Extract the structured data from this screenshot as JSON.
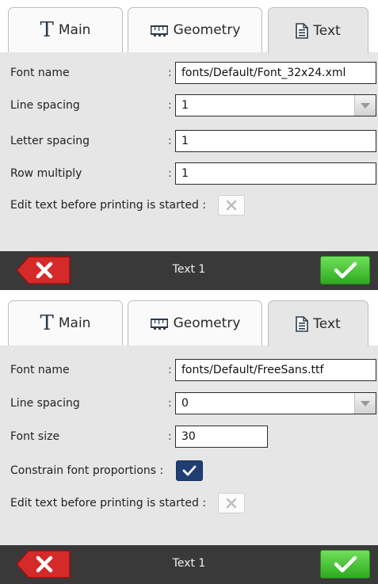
{
  "tabs": {
    "main": "Main",
    "geometry": "Geometry",
    "text": "Text"
  },
  "panel1": {
    "font_name_label": "Font name",
    "font_name_value": "fonts/Default/Font_32x24.xml",
    "line_spacing_label": "Line spacing",
    "line_spacing_value": "1",
    "letter_spacing_label": "Letter spacing",
    "letter_spacing_value": "1",
    "row_multiply_label": "Row multiply",
    "row_multiply_value": "1",
    "edit_text_label": "Edit text before printing is started :",
    "edit_text_checked": false,
    "footer_title": "Text 1"
  },
  "panel2": {
    "font_name_label": "Font name",
    "font_name_value": "fonts/Default/FreeSans.ttf",
    "line_spacing_label": "Line spacing",
    "line_spacing_value": "0",
    "font_size_label": "Font size",
    "font_size_value": "30",
    "constrain_label": "Constrain font proportions :",
    "constrain_checked": true,
    "edit_text_label": "Edit text before printing is started :",
    "edit_text_checked": false,
    "footer_title": "Text 1"
  },
  "colors": {
    "panel_bg": "#e6e6e6",
    "footer_bg": "#393939",
    "ok_green": "#3fc22b",
    "cancel_red": "#d42a2a",
    "checked_blue": "#1f3f72"
  },
  "colon": ":"
}
